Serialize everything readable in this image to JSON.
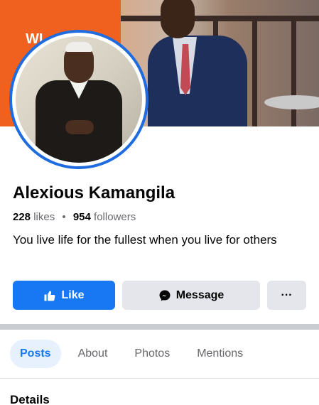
{
  "cover": {
    "overlay_text": "WI"
  },
  "profile": {
    "name": "Alexious Kamangila",
    "likes_count": "228",
    "likes_label": "likes",
    "followers_count": "954",
    "followers_label": "followers",
    "bio": "You live life for the fullest when you live for others"
  },
  "actions": {
    "like_label": "Like",
    "message_label": "Message",
    "more_label": "···"
  },
  "tabs": [
    {
      "label": "Posts",
      "active": true
    },
    {
      "label": "About",
      "active": false
    },
    {
      "label": "Photos",
      "active": false
    },
    {
      "label": "Mentions",
      "active": false
    }
  ],
  "details_heading": "Details",
  "colors": {
    "brand": "#1877f2",
    "ring": "#1f6be0",
    "secondary_button": "#e4e6eb"
  },
  "icons": {
    "like": "thumbs-up-icon",
    "message": "messenger-icon",
    "more": "more-dots-icon"
  }
}
